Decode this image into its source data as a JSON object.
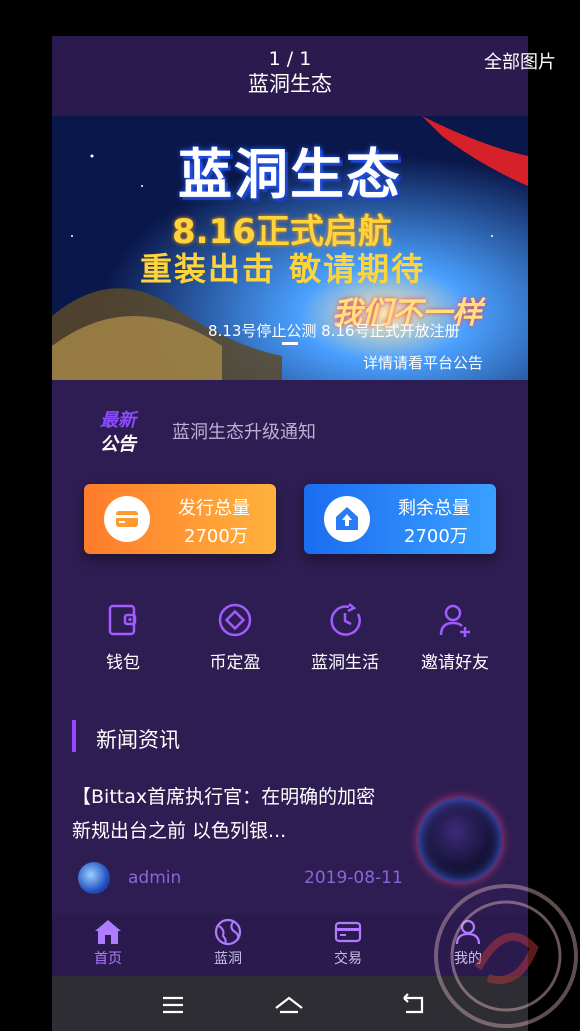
{
  "viewer": {
    "all_photos_label": "全部图片",
    "counter": "1 / 1"
  },
  "header": {
    "title": "蓝洞生态"
  },
  "banner": {
    "title": "蓝洞生态",
    "line1": "8.16正式启航",
    "line2": "重装出击   敬请期待",
    "line3": "我们不一样",
    "line4": "8.13号停止公测    8.16号正式开放注册",
    "line5": "详情请看平台公告"
  },
  "notice": {
    "badge_top": "最新",
    "badge_bottom": "公告",
    "text": "蓝洞生态升级通知"
  },
  "stats": [
    {
      "label": "发行总量",
      "value": "2700万",
      "color": "#ff8a2e",
      "icon": "wallet-card-icon"
    },
    {
      "label": "剩余总量",
      "value": "2700万",
      "color": "#2a7cf5",
      "icon": "home-upload-icon"
    }
  ],
  "quick_menu": [
    {
      "label": "钱包",
      "icon": "wallet-icon"
    },
    {
      "label": "币定盈",
      "icon": "diamond-icon"
    },
    {
      "label": "蓝洞生活",
      "icon": "clock-icon"
    },
    {
      "label": "邀请好友",
      "icon": "invite-user-icon"
    }
  ],
  "news_section": {
    "title": "新闻资讯",
    "article": {
      "text": "【Bittax首席执行官：在明确的加密新规出台之前 以色列银...",
      "author": "admin",
      "date": "2019-08-11"
    }
  },
  "tabbar": [
    {
      "label": "首页",
      "icon": "home-icon",
      "active": true
    },
    {
      "label": "蓝洞",
      "icon": "globe-icon",
      "active": false
    },
    {
      "label": "交易",
      "icon": "card-icon",
      "active": false
    },
    {
      "label": "我的",
      "icon": "user-icon",
      "active": false
    }
  ],
  "colors": {
    "background": "#2e1d52",
    "accent": "#9a46ff",
    "orange": "#ff8a2e",
    "blue": "#2a7cf5"
  }
}
